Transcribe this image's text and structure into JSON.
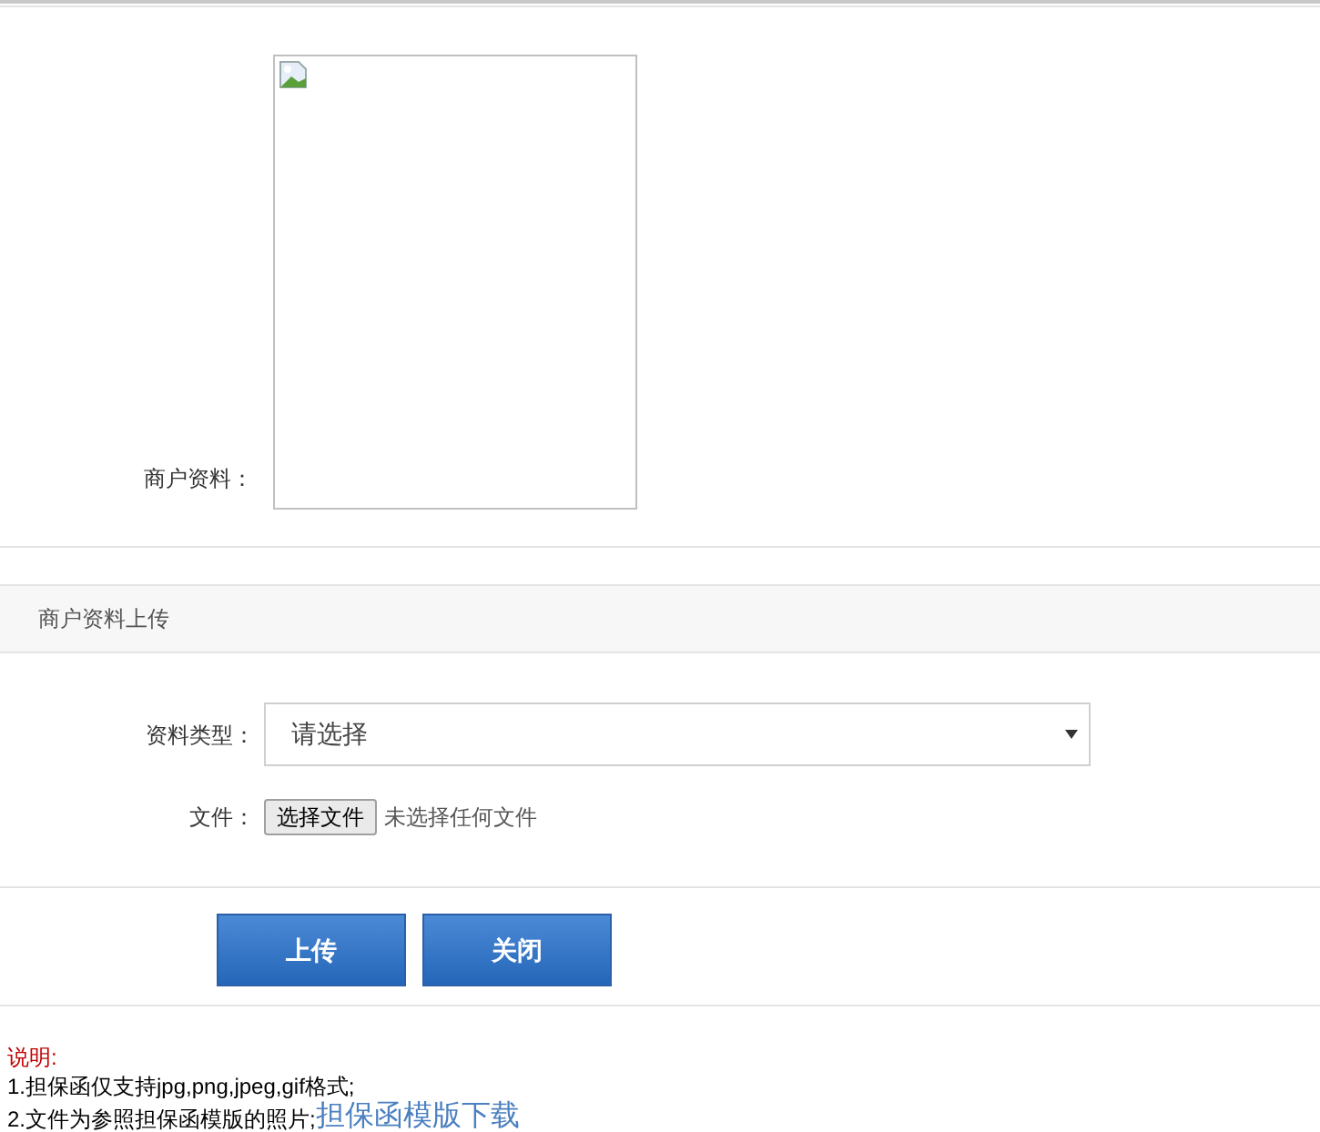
{
  "preview": {
    "label": "商户资料："
  },
  "section": {
    "title": "商户资料上传"
  },
  "form": {
    "type_label": "资料类型：",
    "type_value": "请选择",
    "file_label": "文件：",
    "file_button": "选择文件",
    "file_status": "未选择任何文件"
  },
  "buttons": [
    "上传",
    "关闭"
  ],
  "notes": {
    "title": "说明:",
    "lines": [
      "1.担保函仅支持jpg,png,jpeg,gif格式;",
      "2.文件为参照担保函模版的照片;"
    ],
    "link": "担保函模版下载"
  }
}
